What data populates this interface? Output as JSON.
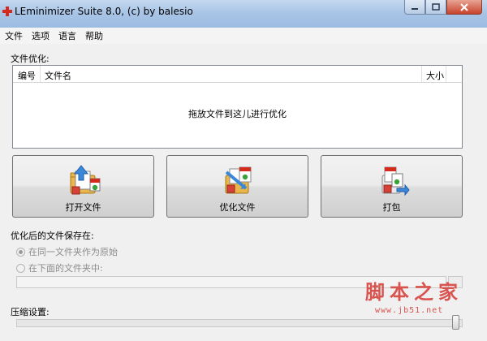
{
  "window": {
    "title": "LEminimizer Suite 8.0, (c) by balesio",
    "controls": [
      "minimize-icon",
      "maximize-icon",
      "close-icon"
    ]
  },
  "menu": {
    "items": [
      "文件",
      "选项",
      "语言",
      "帮助"
    ]
  },
  "file_optimize": {
    "section_label": "文件优化:",
    "columns": {
      "number": "编号",
      "filename": "文件名",
      "size": "大小"
    },
    "drop_hint": "拖放文件到这儿进行优化"
  },
  "actions": {
    "open_label": "打开文件",
    "optimize_label": "优化文件",
    "pack_label": "打包"
  },
  "save_location": {
    "section_label": "优化后的文件保存在:",
    "option_same": "在同一文件夹作为原始",
    "option_below": "在下面的文件夹中:",
    "selected": "option_same",
    "path_value": ""
  },
  "compression": {
    "section_label": "压缩设置:",
    "level": 1.0
  },
  "watermark": {
    "main": "脚本之家",
    "sub": "www.jb51.net"
  },
  "colors": {
    "titlebar": "#a9c5e6",
    "close_button": "#c7432c",
    "watermark": "#d9534f"
  }
}
